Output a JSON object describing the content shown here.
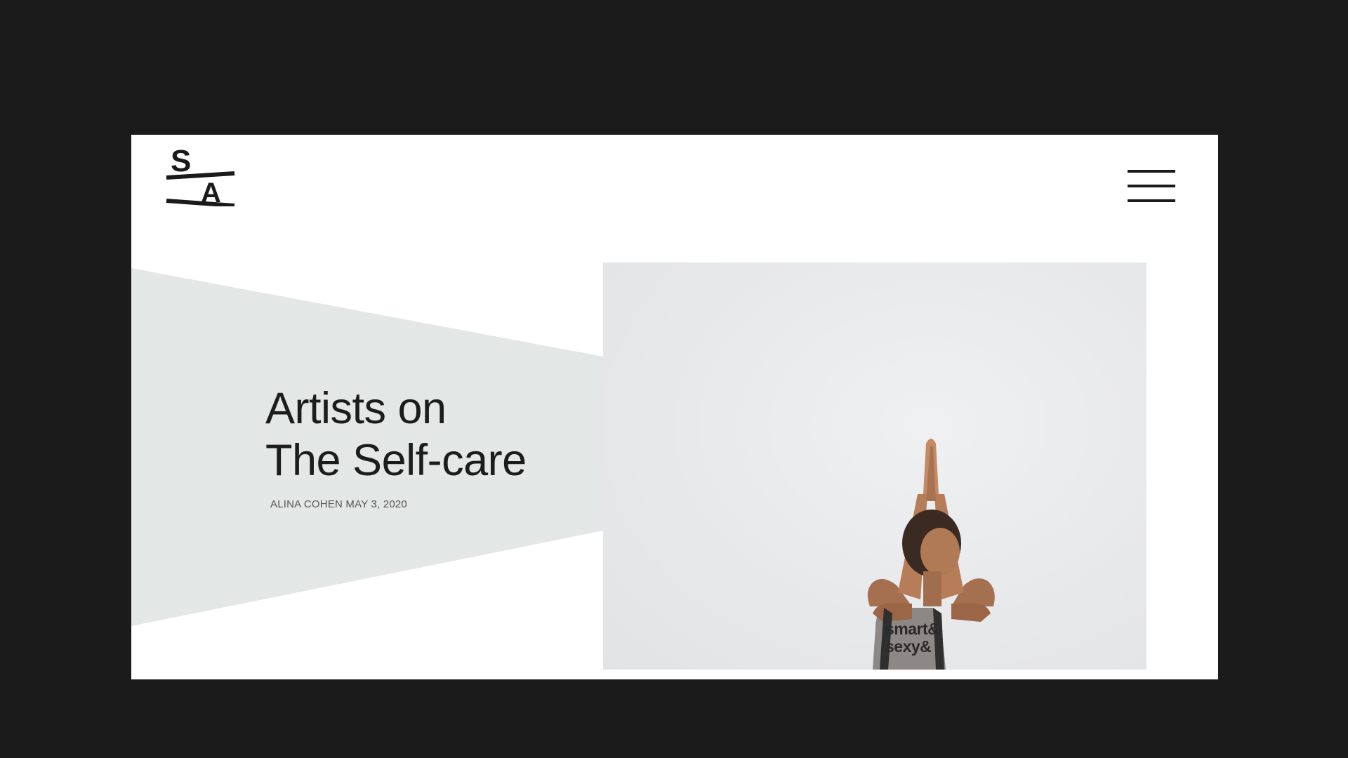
{
  "brand": {
    "logo_letters": [
      "S",
      "A"
    ]
  },
  "header": {
    "menu_icon": "hamburger-menu-icon"
  },
  "hero": {
    "title_lines": [
      "Artists on",
      "The Self-care"
    ],
    "byline": "ALINA COHEN MAY 3, 2020",
    "image": {
      "subject": "woman in prayer pose with raised hands",
      "shirt_text": [
        "smart&",
        "sexy&"
      ]
    }
  },
  "colors": {
    "background": "#1b1b1b",
    "page": "#ffffff",
    "wedge": "#e3e7e6",
    "text": "#1c1c1c",
    "photo_sky": "#e8e9eb"
  }
}
